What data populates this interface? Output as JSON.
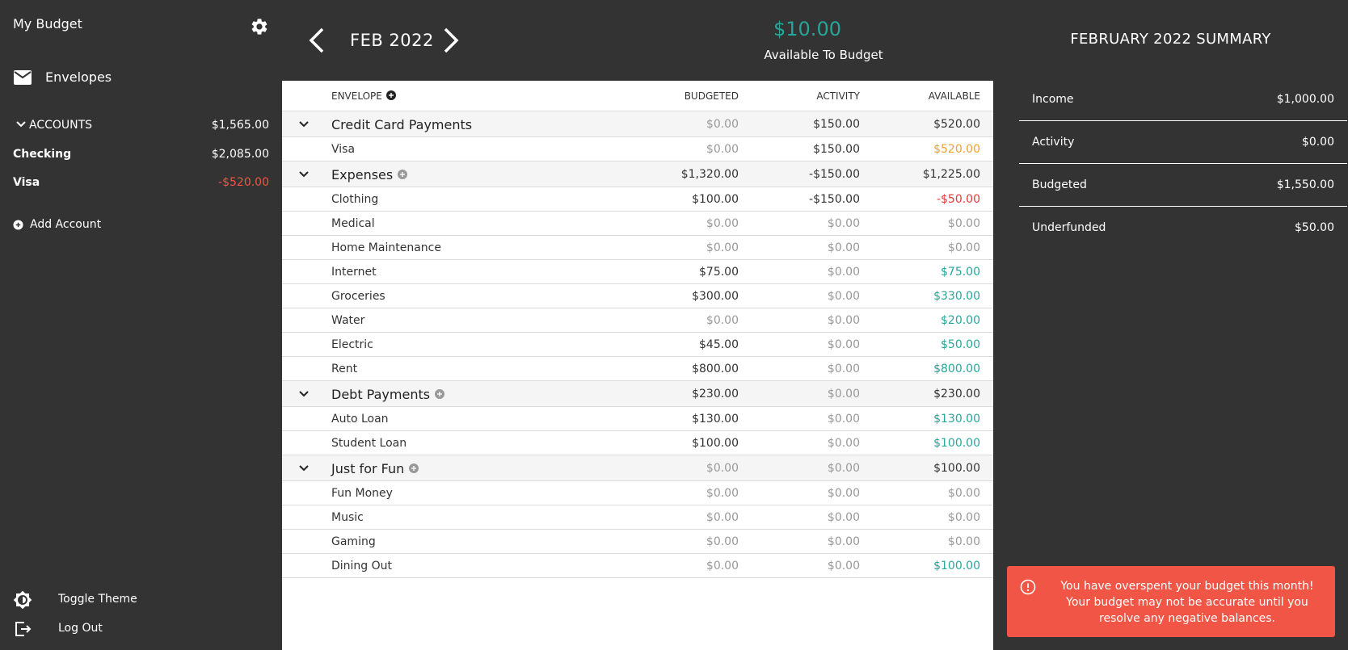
{
  "sidebar": {
    "title": "My Budget",
    "nav_envelopes": "Envelopes",
    "accounts_label": "ACCOUNTS",
    "accounts_total": "$1,565.00",
    "accounts": [
      {
        "name": "Checking",
        "balance": "$2,085.00"
      },
      {
        "name": "Visa",
        "balance": "-$520.00"
      }
    ],
    "add_account": "Add Account",
    "toggle_theme": "Toggle Theme",
    "log_out": "Log Out"
  },
  "header": {
    "month": "FEB 2022",
    "available_amount": "$10.00",
    "available_label": "Available To Budget"
  },
  "table": {
    "col_envelope": "ENVELOPE",
    "col_budgeted": "BUDGETED",
    "col_activity": "ACTIVITY",
    "col_available": "AVAILABLE",
    "groups": [
      {
        "name": "Credit Card Payments",
        "budgeted": "$0.00",
        "activity": "$150.00",
        "available": "$520.00",
        "envelopes": [
          {
            "name": "Visa",
            "budgeted": "$0.00",
            "activity": "$150.00",
            "available": "$520.00"
          }
        ]
      },
      {
        "name": "Expenses",
        "budgeted": "$1,320.00",
        "activity": "-$150.00",
        "available": "$1,225.00",
        "envelopes": [
          {
            "name": "Clothing",
            "budgeted": "$100.00",
            "activity": "-$150.00",
            "available": "-$50.00"
          },
          {
            "name": "Medical",
            "budgeted": "$0.00",
            "activity": "$0.00",
            "available": "$0.00"
          },
          {
            "name": "Home Maintenance",
            "budgeted": "$0.00",
            "activity": "$0.00",
            "available": "$0.00"
          },
          {
            "name": "Internet",
            "budgeted": "$75.00",
            "activity": "$0.00",
            "available": "$75.00"
          },
          {
            "name": "Groceries",
            "budgeted": "$300.00",
            "activity": "$0.00",
            "available": "$330.00"
          },
          {
            "name": "Water",
            "budgeted": "$0.00",
            "activity": "$0.00",
            "available": "$20.00"
          },
          {
            "name": "Electric",
            "budgeted": "$45.00",
            "activity": "$0.00",
            "available": "$50.00"
          },
          {
            "name": "Rent",
            "budgeted": "$800.00",
            "activity": "$0.00",
            "available": "$800.00"
          }
        ]
      },
      {
        "name": "Debt Payments",
        "budgeted": "$230.00",
        "activity": "$0.00",
        "available": "$230.00",
        "envelopes": [
          {
            "name": "Auto Loan",
            "budgeted": "$130.00",
            "activity": "$0.00",
            "available": "$130.00"
          },
          {
            "name": "Student Loan",
            "budgeted": "$100.00",
            "activity": "$0.00",
            "available": "$100.00"
          }
        ]
      },
      {
        "name": "Just for Fun",
        "budgeted": "$0.00",
        "activity": "$0.00",
        "available": "$100.00",
        "envelopes": [
          {
            "name": "Fun Money",
            "budgeted": "$0.00",
            "activity": "$0.00",
            "available": "$0.00"
          },
          {
            "name": "Music",
            "budgeted": "$0.00",
            "activity": "$0.00",
            "available": "$0.00"
          },
          {
            "name": "Gaming",
            "budgeted": "$0.00",
            "activity": "$0.00",
            "available": "$0.00"
          },
          {
            "name": "Dining Out",
            "budgeted": "$0.00",
            "activity": "$0.00",
            "available": "$100.00"
          }
        ]
      }
    ]
  },
  "summary": {
    "title": "FEBRUARY 2022 SUMMARY",
    "rows": [
      {
        "label": "Income",
        "value": "$1,000.00"
      },
      {
        "label": "Activity",
        "value": "$0.00"
      },
      {
        "label": "Budgeted",
        "value": "$1,550.00"
      },
      {
        "label": "Underfunded",
        "value": "$50.00"
      }
    ],
    "alert": "You have overspent your budget this month! Your budget may not be accurate until you resolve any negative balances."
  },
  "colors": {
    "sidebar_bg": "#333333",
    "accent_green": "#26a69a",
    "negative_red": "#e53935",
    "alert_bg": "#f05545",
    "orange": "#f0a030"
  }
}
